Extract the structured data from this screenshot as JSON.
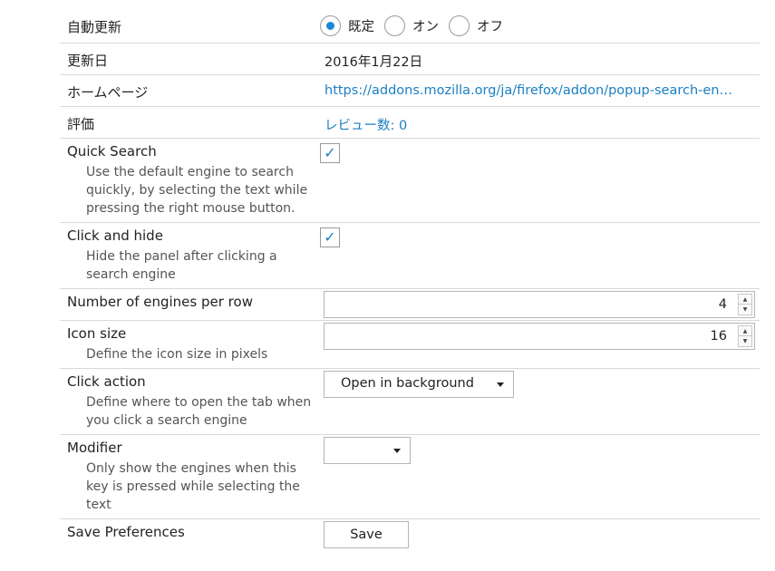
{
  "auto_update": {
    "label": "自動更新",
    "options": [
      {
        "label": "既定",
        "checked": true
      },
      {
        "label": "オン",
        "checked": false
      },
      {
        "label": "オフ",
        "checked": false
      }
    ]
  },
  "updated": {
    "label": "更新日",
    "value": "2016年1月22日"
  },
  "homepage": {
    "label": "ホームページ",
    "value": "https://addons.mozilla.org/ja/firefox/addon/popup-search-en…"
  },
  "rating": {
    "label": "評価",
    "value": "レビュー数: 0"
  },
  "quick_search": {
    "label": "Quick Search",
    "desc": "Use the default engine to search quickly, by selecting the text while pressing the right mouse button.",
    "checked": true
  },
  "click_hide": {
    "label": "Click and hide",
    "desc": "Hide the panel after clicking a search engine",
    "checked": true
  },
  "engines_per_row": {
    "label": "Number of engines per row",
    "value": "4"
  },
  "icon_size": {
    "label": "Icon size",
    "desc": "Define the icon size in pixels",
    "value": "16"
  },
  "click_action": {
    "label": "Click action",
    "desc": "Define where to open the tab when you click a search engine",
    "selected": "Open in background"
  },
  "modifier": {
    "label": "Modifier",
    "desc": "Only show the engines when this key is pressed while selecting the text",
    "selected": ""
  },
  "save_prefs": {
    "label": "Save Preferences",
    "button": "Save"
  },
  "icons": {
    "check": "checkmark-icon",
    "caret": "chevron-down-icon",
    "spin_up": "spin-up-icon",
    "spin_down": "spin-down-icon"
  },
  "colors": {
    "accent": "#1a8ad6",
    "link": "#1a7fc2",
    "border": "#d8d8d8"
  }
}
